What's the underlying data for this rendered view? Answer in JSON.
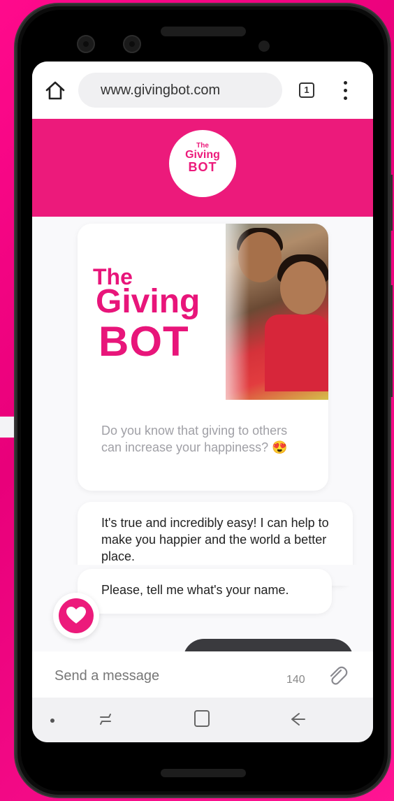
{
  "browser": {
    "url": "www.givingbot.com",
    "tab_count": "1"
  },
  "header": {
    "logo_line1": "The",
    "logo_line2": "Giving",
    "logo_line3": "BOT"
  },
  "card": {
    "title_the": "The",
    "title_giving": "Giving",
    "title_bot": "BOT",
    "text": "Do you know that giving to others can increase your happiness? 😍"
  },
  "messages": [
    {
      "text": "It's true and incredibly easy! I can help to make you happier and the world a better place."
    },
    {
      "text": "Please, tell me what's your name."
    }
  ],
  "composer": {
    "placeholder": "Send a message",
    "char_count": "140"
  },
  "colors": {
    "brand": "#ec1a7b",
    "background": "#ff0a8c",
    "user_bubble": "#3a3a3e"
  },
  "icons": [
    "home-icon",
    "tabs-icon",
    "more-vert-icon",
    "heart-icon",
    "paperclip-icon",
    "recents-icon",
    "home-square-icon",
    "back-arrow-icon"
  ]
}
